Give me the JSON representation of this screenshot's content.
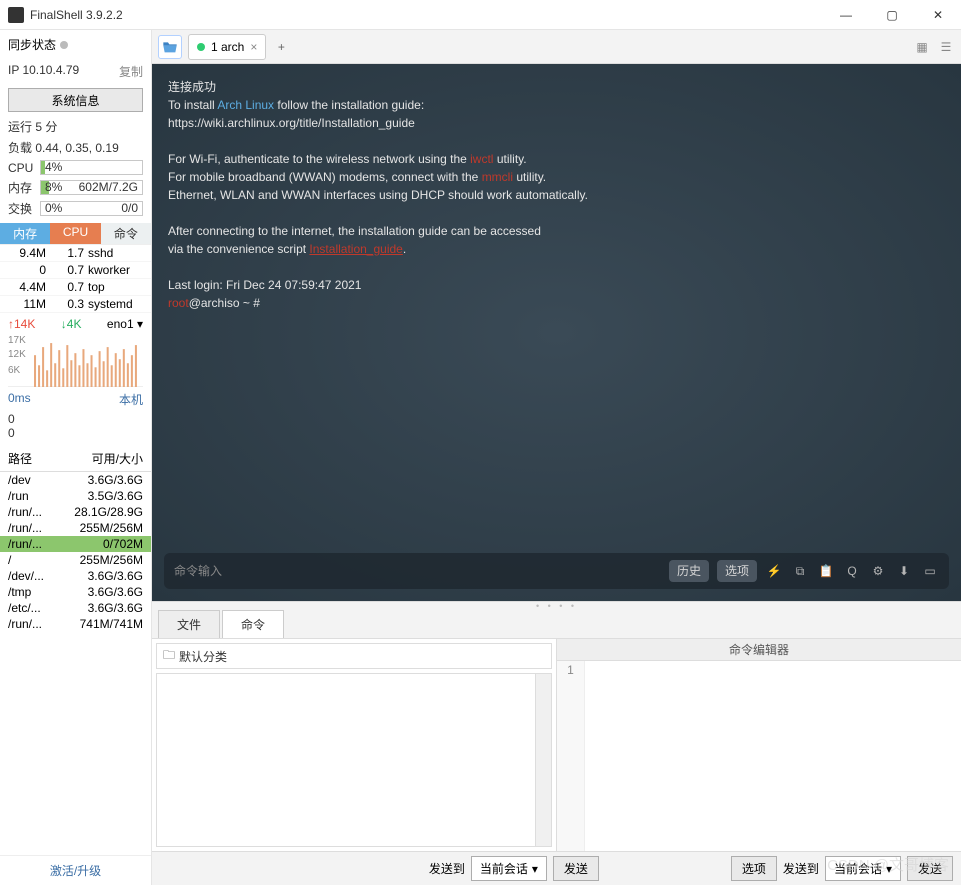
{
  "title": "FinalShell 3.9.2.2",
  "window": {
    "min": "—",
    "max": "▢",
    "close": "✕"
  },
  "sidebar": {
    "sync_label": "同步状态",
    "ip": "IP 10.10.4.79",
    "copy": "复制",
    "sysinfo": "系统信息",
    "uptime": "运行 5 分",
    "load": "负载 0.44, 0.35, 0.19",
    "cpu": {
      "lbl": "CPU",
      "pct": "4%",
      "fill": 4
    },
    "mem": {
      "lbl": "内存",
      "pct": "8%",
      "det": "602M/7.2G",
      "fill": 8
    },
    "swap": {
      "lbl": "交换",
      "pct": "0%",
      "det": "0/0",
      "fill": 0
    },
    "tabs": {
      "m": "内存",
      "c": "CPU",
      "cmd": "命令"
    },
    "proc": [
      {
        "m": "9.4M",
        "c": "1.7",
        "n": "sshd"
      },
      {
        "m": "0",
        "c": "0.7",
        "n": "kworker"
      },
      {
        "m": "4.4M",
        "c": "0.7",
        "n": "top"
      },
      {
        "m": "11M",
        "c": "0.3",
        "n": "systemd"
      }
    ],
    "net": {
      "up": "↑14K",
      "dn": "↓4K",
      "if": "eno1 ▾"
    },
    "ylabels": [
      "17K",
      "12K",
      "6K"
    ],
    "lat": {
      "v": "0ms",
      "host": "本机",
      "l1": "0",
      "l2": "0"
    },
    "fshdr": {
      "p": "路径",
      "s": "可用/大小"
    },
    "fs": [
      {
        "p": "/dev",
        "s": "3.6G/3.6G"
      },
      {
        "p": "/run",
        "s": "3.5G/3.6G"
      },
      {
        "p": "/run/...",
        "s": "28.1G/28.9G"
      },
      {
        "p": "/run/...",
        "s": "255M/256M"
      },
      {
        "p": "/run/...",
        "s": "0/702M",
        "hl": true
      },
      {
        "p": "/",
        "s": "255M/256M"
      },
      {
        "p": "/dev/...",
        "s": "3.6G/3.6G"
      },
      {
        "p": "/tmp",
        "s": "3.6G/3.6G"
      },
      {
        "p": "/etc/...",
        "s": "3.6G/3.6G"
      },
      {
        "p": "/run/...",
        "s": "741M/741M"
      }
    ],
    "activate": "激活/升级"
  },
  "tabbar": {
    "tab": "1 arch",
    "close": "×",
    "add": "+"
  },
  "terminal": {
    "l1": "连接成功",
    "l2a": "To install ",
    "l2b": "Arch Linux",
    "l2c": " follow the installation guide:",
    "l3": "https://wiki.archlinux.org/title/Installation_guide",
    "l4a": "For Wi-Fi, authenticate to the wireless network using the ",
    "l4b": "iwctl",
    "l4c": " utility.",
    "l5a": "For mobile broadband (WWAN) modems, connect with the ",
    "l5b": "mmcli",
    "l5c": " utility.",
    "l6": "Ethernet, WLAN and WWAN interfaces using DHCP should work automatically.",
    "l7": "After connecting to the internet, the installation guide can be accessed",
    "l8a": "via the convenience script ",
    "l8b": "Installation_guide",
    "l8c": ".",
    "l9": "Last login: Fri Dec 24 07:59:47 2021",
    "p1": "root",
    "p2": "@archiso ~ #"
  },
  "cmdbar": {
    "placeholder": "命令输入",
    "history": "历史",
    "options": "选项"
  },
  "bottom": {
    "tab_file": "文件",
    "tab_cmd": "命令",
    "default_cat": "默认分类",
    "editor_title": "命令编辑器",
    "line": "1",
    "sendto": "发送到",
    "cur": "当前会话",
    "send": "发送",
    "opt": "选项",
    "sendto2": "发送到",
    "cur2": "当前会话",
    "send2": "发送"
  },
  "watermark": "CSDN @文哥博客"
}
